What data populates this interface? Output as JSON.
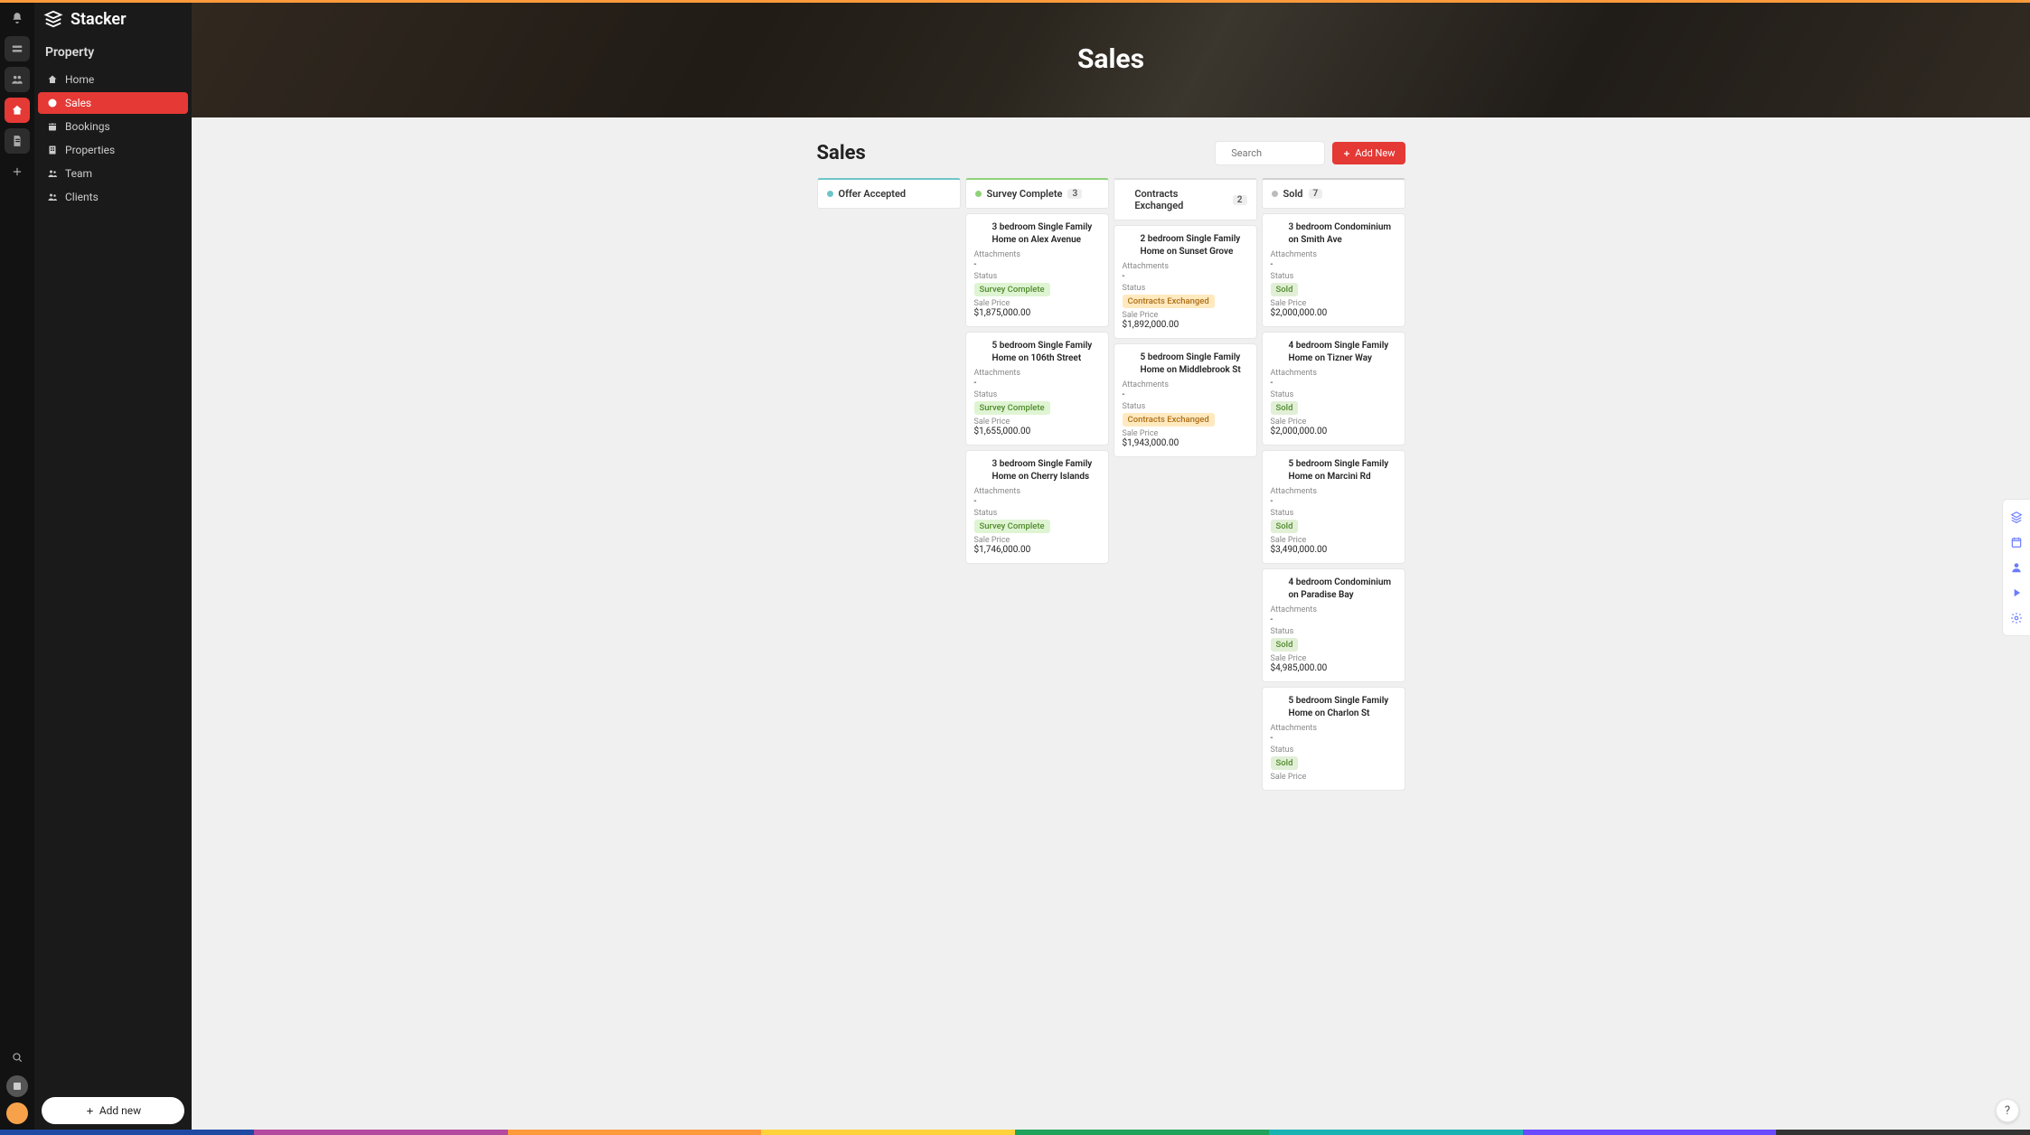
{
  "brand": "Stacker",
  "workspace": "Property",
  "hero_title": "Sales",
  "page_title": "Sales",
  "search_placeholder": "Search",
  "add_new_label": "Add New",
  "sidebar_add_label": "Add new",
  "help_glyph": "?",
  "nav": [
    {
      "id": "home",
      "label": "Home",
      "icon": "home"
    },
    {
      "id": "sales",
      "label": "Sales",
      "icon": "alert",
      "active": true
    },
    {
      "id": "bookings",
      "label": "Bookings",
      "icon": "calendar"
    },
    {
      "id": "properties",
      "label": "Properties",
      "icon": "building"
    },
    {
      "id": "team",
      "label": "Team",
      "icon": "users"
    },
    {
      "id": "clients",
      "label": "Clients",
      "icon": "users"
    }
  ],
  "rail": {
    "top": [
      {
        "id": "bell",
        "icon": "bell"
      },
      {
        "id": "app1",
        "icon": "badge",
        "style": "square"
      },
      {
        "id": "app2",
        "icon": "people",
        "style": "square"
      },
      {
        "id": "app3",
        "icon": "home",
        "style": "active"
      },
      {
        "id": "app4",
        "icon": "doc",
        "style": "square"
      },
      {
        "id": "add",
        "icon": "plus"
      }
    ]
  },
  "field_labels": {
    "attachments": "Attachments",
    "attachments_empty": "-",
    "status": "Status",
    "price": "Sale Price"
  },
  "columns": [
    {
      "id": "offer",
      "label": "Offer Accepted",
      "count": null,
      "cards": []
    },
    {
      "id": "survey",
      "label": "Survey Complete",
      "count": 3,
      "cards": [
        {
          "title": "3 bedroom Single Family Home on Alex Avenue",
          "status": "Survey Complete",
          "status_kind": "survey",
          "price": "$1,875,000.00"
        },
        {
          "title": "5 bedroom Single Family Home on 106th Street",
          "status": "Survey Complete",
          "status_kind": "survey",
          "price": "$1,655,000.00"
        },
        {
          "title": "3 bedroom Single Family Home on Cherry Islands",
          "status": "Survey Complete",
          "status_kind": "survey",
          "price": "$1,746,000.00"
        }
      ]
    },
    {
      "id": "contracts",
      "label": "Contracts Exchanged",
      "count": 2,
      "cards": [
        {
          "title": "2 bedroom Single Family Home on Sunset Grove",
          "status": "Contracts Exchanged",
          "status_kind": "contracts",
          "price": "$1,892,000.00"
        },
        {
          "title": "5 bedroom Single Family Home on Middlebrook St",
          "status": "Contracts Exchanged",
          "status_kind": "contracts",
          "price": "$1,943,000.00"
        }
      ]
    },
    {
      "id": "sold",
      "label": "Sold",
      "count": 7,
      "cards": [
        {
          "title": "3 bedroom Condominium on Smith Ave",
          "status": "Sold",
          "status_kind": "sold",
          "price": "$2,000,000.00"
        },
        {
          "title": "4 bedroom Single Family Home on Tizner Way",
          "status": "Sold",
          "status_kind": "sold",
          "price": "$2,000,000.00"
        },
        {
          "title": "5 bedroom Single Family Home on Marcini Rd",
          "status": "Sold",
          "status_kind": "sold",
          "price": "$3,490,000.00"
        },
        {
          "title": "4 bedroom Condominium on Paradise Bay",
          "status": "Sold",
          "status_kind": "sold",
          "price": "$4,985,000.00"
        },
        {
          "title": "5 bedroom Single Family Home on Charlon St",
          "status": "Sold",
          "status_kind": "sold",
          "price": ""
        }
      ]
    }
  ],
  "right_tools": [
    {
      "id": "layers",
      "icon": "layers"
    },
    {
      "id": "calendar",
      "icon": "calendar"
    },
    {
      "id": "user",
      "icon": "user"
    },
    {
      "id": "play",
      "icon": "play"
    },
    {
      "id": "settings",
      "icon": "gear"
    }
  ],
  "bottom_accent_colors": [
    "#1e4aa3",
    "#b44aa0",
    "#ff9a3c",
    "#ffd23c",
    "#1fa35a",
    "#19b3b3",
    "#6a4aff",
    "#333333"
  ]
}
